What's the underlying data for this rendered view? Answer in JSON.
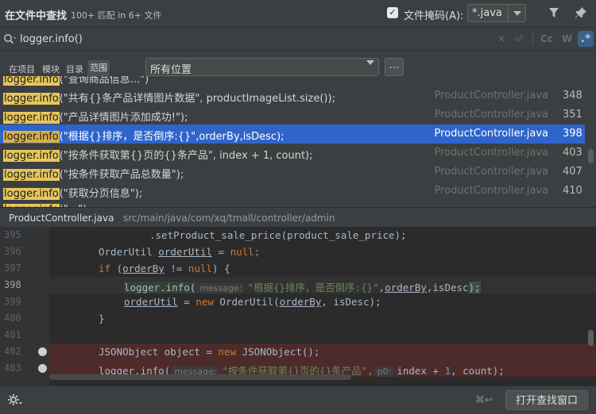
{
  "header": {
    "title": "在文件中查找",
    "match_count": "100+ 匹配 in 6+ 文件",
    "file_mask_label": "文件掩码(A):",
    "file_mask_value": "*.java"
  },
  "search": {
    "query": "logger.info()",
    "toggles": [
      "Cc",
      "W",
      ".*"
    ]
  },
  "scope": {
    "tabs": [
      "在项目",
      "模块",
      "目录",
      "范围"
    ],
    "active_tab": "范围",
    "location_value": "所有位置",
    "more_label": "..."
  },
  "results": [
    {
      "match": "logger.info",
      "rest": "(\"共有{}条产品详情图片数据\", productImageList.size());",
      "file": "ProductController.java",
      "line": "348"
    },
    {
      "match": "logger.info",
      "rest": "(\"产品详情图片添加成功!\");",
      "file": "ProductController.java",
      "line": "351"
    },
    {
      "match": "logger.info",
      "rest": "(\"根据{}排序，是否倒序:{}\",orderBy,isDesc);",
      "file": "ProductController.java",
      "line": "398"
    },
    {
      "match": "logger.info",
      "rest": "(\"按条件获取第{}页的{}条产品\", index + 1, count);",
      "file": "ProductController.java",
      "line": "403"
    },
    {
      "match": "logger.info",
      "rest": "(\"按条件获取产品总数量\");",
      "file": "ProductController.java",
      "line": "407"
    },
    {
      "match": "logger.info",
      "rest": "(\"获取分页信息\");",
      "file": "ProductController.java",
      "line": "410"
    }
  ],
  "preview": {
    "file": "ProductController.java",
    "path": "src/main/java/com/xq/tmall/controller/admin"
  },
  "code": {
    "lines": [
      "395",
      "396",
      "397",
      "398",
      "399",
      "400",
      "401",
      "402",
      "403"
    ],
    "l395": ".setProduct_sale_price(product_sale_price);",
    "l396_a": "OrderUtil ",
    "l396_var": "orderUtil",
    "l396_b": " = ",
    "l396_kw": "null",
    "l397_kw": "if",
    "l397_a": " (",
    "l397_var": "orderBy",
    "l397_b": " != ",
    "l397_kw2": "null",
    "l397_c": ") {",
    "l398_m": "logger.info(",
    "l398_hint": "message:",
    "l398_str": "\"根据{}排序，是否倒序:{}\"",
    "l398_var": "orderBy",
    "l398_rest": ",isDesc",
    "l398_end": ");",
    "l399_var": "orderUtil",
    "l399_a": " = ",
    "l399_kw": "new",
    "l399_b": " OrderUtil(",
    "l399_var2": "orderBy",
    "l399_c": ", isDesc);",
    "l400": "}",
    "l402_a": "JSONObject object = ",
    "l402_kw": "new",
    "l402_b": " JSONObject();",
    "l403_m": "logger.info(",
    "l403_hint": "message:",
    "l403_str": "\"按条件获取第{}页的{}条产品\",",
    "l403_hint2": "p0:",
    "l403_a": "index + ",
    "l403_num": "1",
    "l403_b": ", count);"
  },
  "footer": {
    "shortcut": "⌘↩",
    "open_button": "打开查找窗口"
  }
}
